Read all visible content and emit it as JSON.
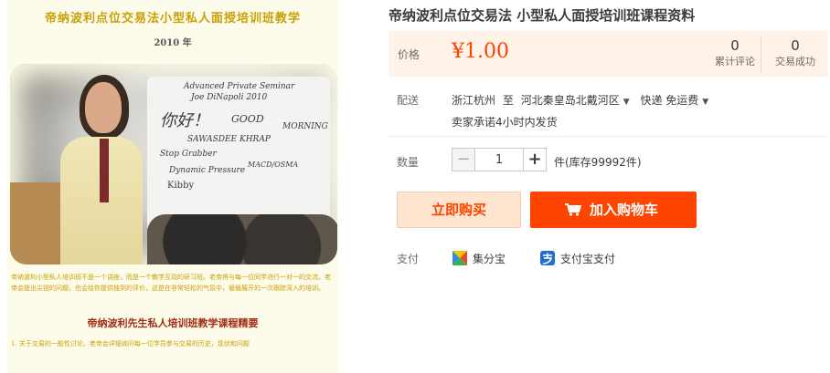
{
  "image": {
    "title": "帝纳波利点位交易法小型私人面授培训班教学",
    "year": "2010 年",
    "board_lines": [
      "Advanced Private Seminar",
      "Joe DiNapoli  2010",
      "你好！",
      "GOOD",
      "MORNING",
      "SAWASDEE KHRAP",
      "Stop Grabber",
      "MACD/OSMA",
      "Dynamic Pressure",
      "Kibby"
    ],
    "paragraph": "帝纳波利小型私人培训班不是一个讲座，而是一个教学互动的研习班。老帝将与每一位同学进行一对一的交流。老帝会提出尖锐的问题，也会给你提供独到的评价，这是在非常轻松的气氛中，循循展开的一次跟踪深入的培训。",
    "subtitle": "帝纳波利先生私人培训班教学课程精要",
    "item": "1.  关于交易的一般性讨论。老帝会详细询问每一位学员参与交易的历史，现状和问题"
  },
  "product": {
    "title": "帝纳波利点位交易法 小型私人面授培训班课程资料"
  },
  "price": {
    "label": "价格",
    "value": "¥1.00"
  },
  "stats": {
    "reviews": {
      "count": "0",
      "label": "累计评论"
    },
    "trades": {
      "count": "0",
      "label": "交易成功"
    }
  },
  "shipping": {
    "label": "配送",
    "origin": "浙江杭州",
    "to_word": "至",
    "destination": "河北秦皇岛北戴河区",
    "method": "快递 免运费",
    "promise": "卖家承诺4小时内发货"
  },
  "quantity": {
    "label": "数量",
    "value": "1",
    "minus": "−",
    "plus": "+",
    "stock": "件(库存99992件)"
  },
  "actions": {
    "buy_now": "立即购买",
    "add_to_cart": "加入购物车"
  },
  "payment": {
    "label": "支付",
    "methods": [
      "集分宝",
      "支付宝支付"
    ]
  },
  "colors": {
    "accent": "#ff4400",
    "price_bg": "#fff2e8",
    "buy_bg": "#ffe4d0"
  },
  "icons": [
    "cart-icon",
    "jifenbao-icon",
    "alipay-icon",
    "caret-down-icon"
  ]
}
